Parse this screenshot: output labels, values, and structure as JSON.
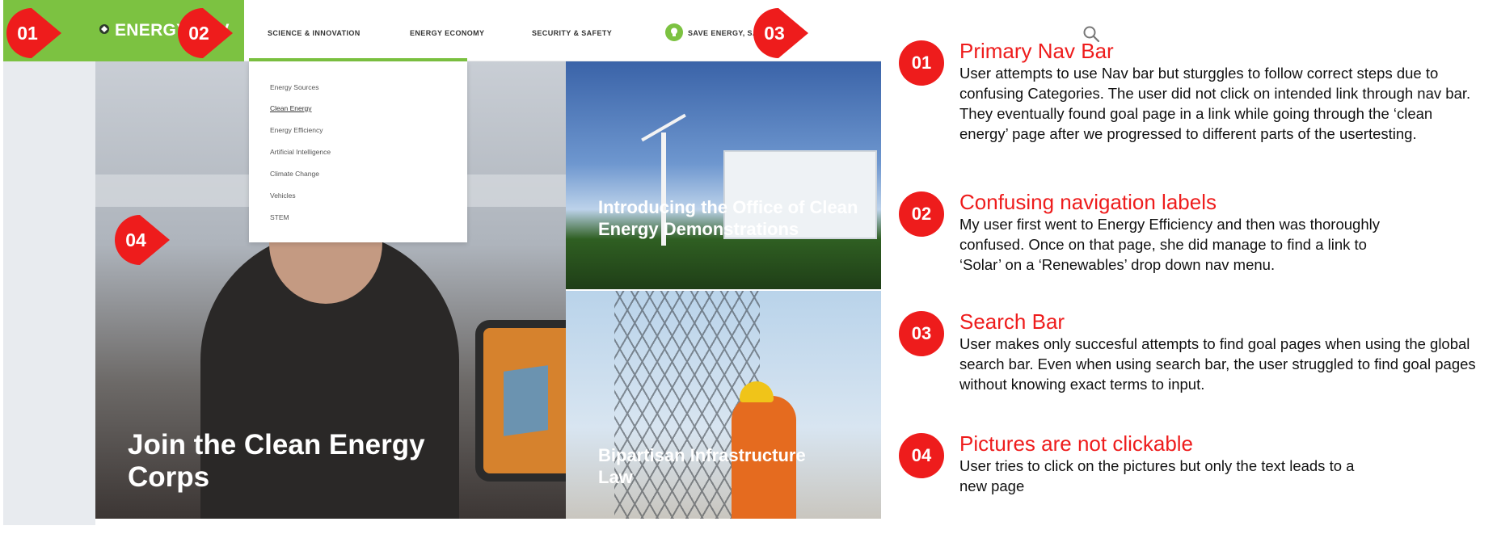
{
  "site": {
    "logo": "ENERGY.GOV",
    "nav": [
      {
        "label": "SCIENCE & INNOVATION"
      },
      {
        "label": "ENERGY ECONOMY"
      },
      {
        "label": "SECURITY & SAFETY"
      },
      {
        "label": "SAVE ENERGY, SAVE MONEY"
      }
    ],
    "dropdown": [
      "Energy Sources",
      "Clean Energy",
      "Energy Efficiency",
      "Artificial Intelligence",
      "Climate Change",
      "Vehicles",
      "STEM"
    ],
    "hero_title": "Join the Clean Energy Corps",
    "tile1_title": "Introducing the Office of Clean Energy Demonstrations",
    "tile2_title": "Bipartisan Infrastructure Law"
  },
  "badges": [
    "01",
    "02",
    "03",
    "04"
  ],
  "notes": [
    {
      "number": "01",
      "title": "Primary Nav Bar",
      "body": "User attempts to use Nav bar but sturggles to follow correct steps due to confusing Categories. The user did not click on intended link through nav bar. They eventually found goal page in a link while going through the ‘clean energy’ page after we progressed to different parts of the usertesting."
    },
    {
      "number": "02",
      "title": "Confusing navigation labels",
      "body": "My user first went to Energy Efficiency and then was thoroughly confused. Once on that page, she did manage to find a link to ‘Solar’ on a ‘Renewables’ drop down nav menu."
    },
    {
      "number": "03",
      "title": "Search Bar",
      "body": "User makes only succesful attempts to find goal pages when using the global search bar. Even when using search bar, the user struggled to find goal pages without knowing exact terms to input."
    },
    {
      "number": "04",
      "title": "Pictures are not clickable",
      "body": "User tries to click on the pictures but only the text leads to a new page"
    }
  ],
  "colors": {
    "brand_green": "#7cc241",
    "annotation_red": "#ee1c1c"
  }
}
